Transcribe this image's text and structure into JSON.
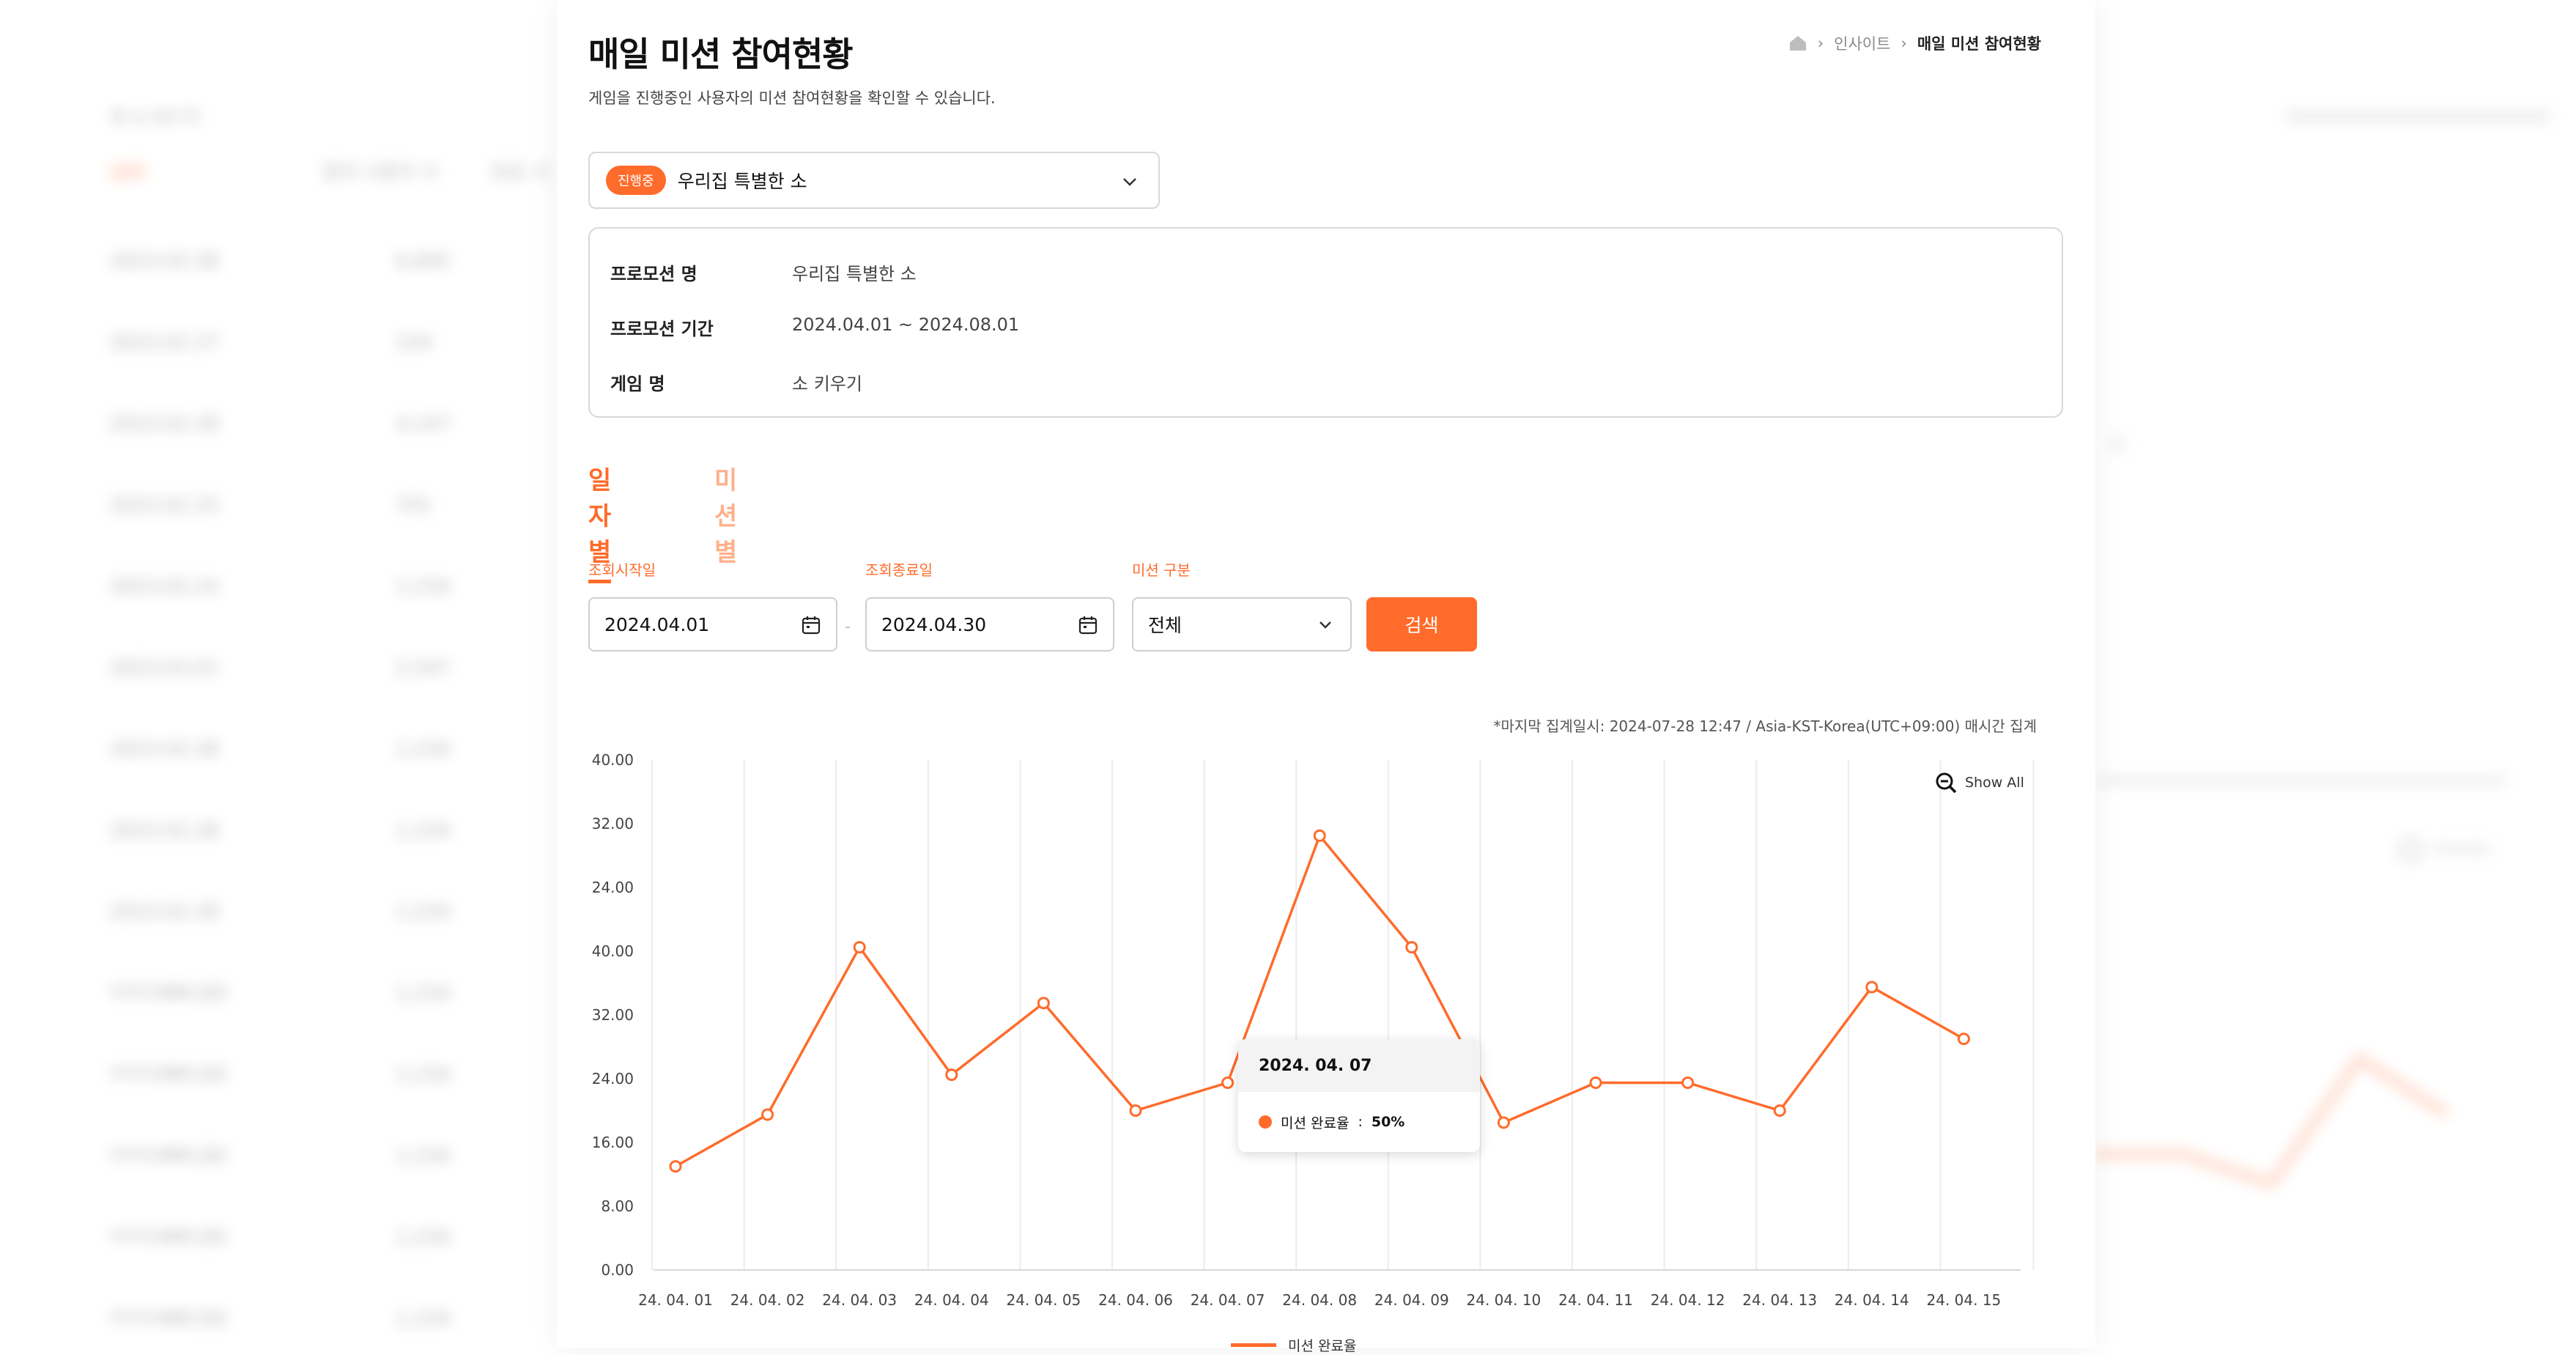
{
  "page": {
    "title": "매일 미션 참여현황",
    "description": "게임을 진행중인 사용자의 미션 참여현황을 확인할 수 있습니다."
  },
  "breadcrumb": {
    "items": [
      "인사이트",
      "매일 미션 참여현황"
    ]
  },
  "promotion_select": {
    "status": "진행중",
    "selected": "우리집 특별한 소"
  },
  "info": [
    {
      "label": "프로모션 명",
      "value": "우리집 특별한 소"
    },
    {
      "label": "프로모션 기간",
      "value": "2024.04.01 ~ 2024.08.01"
    },
    {
      "label": "게임 명",
      "value": "소 키우기"
    }
  ],
  "tabs": [
    {
      "label": "일자별",
      "active": true
    },
    {
      "label": "미션별",
      "active": false
    }
  ],
  "filters": {
    "start_label": "조회시작일",
    "start_value": "2024.04.01",
    "end_label": "조회종료일",
    "end_value": "2024.04.30",
    "dash": "-",
    "mission_label": "미션 구분",
    "mission_value": "전체",
    "search_button": "검색"
  },
  "aggregation_note": "*마지막 집계일시: 2024-07-28 12:47 / Asia-KST-Korea(UTC+09:00) 매시간 집계",
  "show_all": "Show All",
  "tooltip": {
    "date": "2024. 04. 07",
    "series": "미션 완료율",
    "value": "50%"
  },
  "legend": {
    "label": "미션 완료율"
  },
  "colors": {
    "accent": "#ff6b2b",
    "accent_light": "#ffb08a",
    "border": "#d8d8d8"
  },
  "chart_data": {
    "type": "line",
    "title": "",
    "xlabel": "",
    "ylabel": "",
    "x": [
      "24. 04. 01",
      "24. 04. 02",
      "24. 04. 03",
      "24. 04. 04",
      "24. 04. 05",
      "24. 04. 06",
      "24. 04. 07",
      "24. 04. 08",
      "24. 04. 09",
      "24. 04. 10",
      "24. 04. 11",
      "24. 04. 12",
      "24. 04. 13",
      "24. 04. 14",
      "24. 04. 15"
    ],
    "y_tick_labels": [
      "40.00",
      "32.00",
      "24.00",
      "40.00",
      "32.00",
      "24.00",
      "16.00",
      "8.00",
      "0.00"
    ],
    "ylim": [
      0,
      64
    ],
    "grid": "vertical",
    "series": [
      {
        "name": "미션 완료율",
        "values": [
          13,
          19.5,
          40.5,
          24.5,
          33.5,
          20,
          23.5,
          54.5,
          40.5,
          18.5,
          23.5,
          23.5,
          20,
          35.5,
          29
        ]
      }
    ],
    "legend_position": "bottom"
  },
  "background_left": {
    "header": "총 6,387개",
    "col1": "날짜",
    "col2": "참여 사용자 수",
    "col3": "완료 사",
    "rows": [
      [
        "2023.02.28",
        "6,845"
      ],
      [
        "2023.02.27",
        "234"
      ],
      [
        "2023.02.28",
        "4,147"
      ],
      [
        "2023.02.25",
        "701"
      ],
      [
        "2023.02.24",
        "1,234"
      ],
      [
        "2023.03.01",
        "2,547"
      ],
      [
        "2023.02.28",
        "1,234"
      ],
      [
        "2023.02.28",
        "1,234"
      ],
      [
        "2023.02.28",
        "1,234"
      ],
      [
        "YYYY.MM.DD",
        "1,234"
      ],
      [
        "YYYY.MM.DD",
        "1,234"
      ],
      [
        "YYYY.MM.DD",
        "1,234"
      ],
      [
        "YYYY.MM.DD",
        "1,234"
      ],
      [
        "YYYY.MM.DD",
        "1,234"
      ]
    ]
  }
}
